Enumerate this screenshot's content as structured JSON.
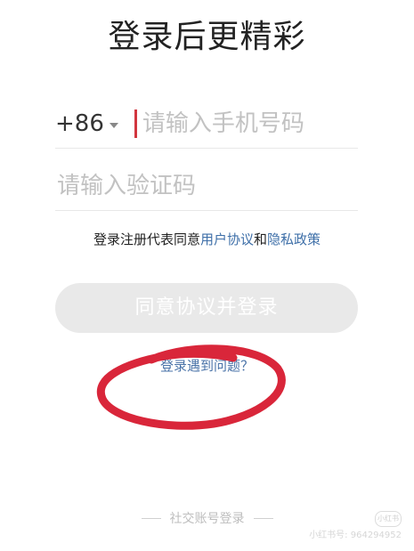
{
  "header": {
    "title": "登录后更精彩"
  },
  "phone": {
    "country_code": "+86",
    "placeholder": "请输入手机号码"
  },
  "verification": {
    "placeholder": "请输入验证码"
  },
  "agreement": {
    "prefix": "登录注册代表同意",
    "user_agreement": "用户协议",
    "conjunction": "和",
    "privacy_policy": "隐私政策"
  },
  "submit": {
    "label": "同意协议并登录"
  },
  "help": {
    "label": "登录遇到问题？"
  },
  "social": {
    "label": "社交账号登录"
  },
  "watermark": {
    "badge": "小红书",
    "text": "小红书号: 964294952"
  },
  "colors": {
    "accent_link": "#3e6fa8",
    "cursor": "#d2363f",
    "annotation": "#d9263a",
    "button_bg": "#e9e9e9"
  }
}
